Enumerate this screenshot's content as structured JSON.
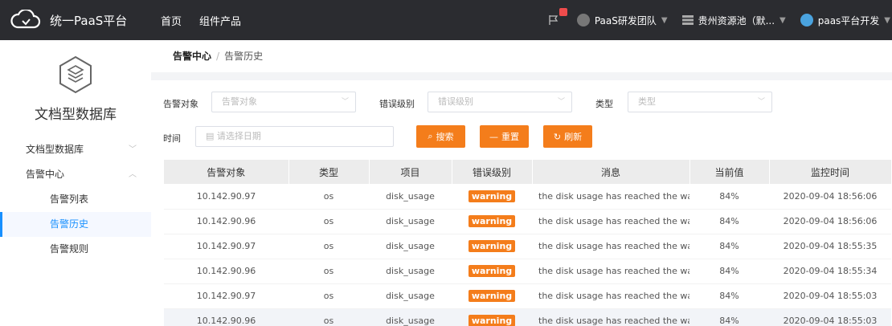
{
  "header": {
    "app_title": "统一PaaS平台",
    "nav": [
      "首页",
      "组件产品"
    ],
    "team": "PaaS研发团队",
    "pool": "贵州资源池（默...",
    "user": "paas平台开发"
  },
  "sidebar": {
    "db_title": "文档型数据库",
    "items": [
      {
        "label": "文档型数据库"
      },
      {
        "label": "告警中心"
      },
      {
        "label": "告警列表"
      },
      {
        "label": "告警历史"
      },
      {
        "label": "告警规则"
      }
    ]
  },
  "breadcrumb": {
    "parent": "告警中心",
    "sep": "/",
    "current": "告警历史"
  },
  "filters": {
    "target": {
      "label": "告警对象",
      "placeholder": "告警对象"
    },
    "level": {
      "label": "错误级别",
      "placeholder": "错误级别"
    },
    "type": {
      "label": "类型",
      "placeholder": "类型"
    },
    "time": {
      "label": "时间",
      "placeholder": "请选择日期"
    }
  },
  "buttons": {
    "search": "搜索",
    "reset": "重置",
    "refresh": "刷新"
  },
  "table": {
    "headers": [
      "告警对象",
      "类型",
      "项目",
      "错误级别",
      "消息",
      "当前值",
      "监控时间"
    ],
    "rows": [
      [
        "10.142.90.97",
        "os",
        "disk_usage",
        "warning",
        "the disk usage has reached the warn...",
        "84%",
        "2020-09-04 18:56:06"
      ],
      [
        "10.142.90.96",
        "os",
        "disk_usage",
        "warning",
        "the disk usage has reached the warn...",
        "84%",
        "2020-09-04 18:56:06"
      ],
      [
        "10.142.90.97",
        "os",
        "disk_usage",
        "warning",
        "the disk usage has reached the warn...",
        "84%",
        "2020-09-04 18:55:35"
      ],
      [
        "10.142.90.96",
        "os",
        "disk_usage",
        "warning",
        "the disk usage has reached the warn...",
        "84%",
        "2020-09-04 18:55:34"
      ],
      [
        "10.142.90.97",
        "os",
        "disk_usage",
        "warning",
        "the disk usage has reached the warn...",
        "84%",
        "2020-09-04 18:55:03"
      ],
      [
        "10.142.90.96",
        "os",
        "disk_usage",
        "warning",
        "the disk usage has reached the warn...",
        "84%",
        "2020-09-04 18:55:03"
      ]
    ]
  },
  "colors": {
    "topbar": "#2b2c30",
    "accent": "#f47d1b",
    "active": "#1890ff",
    "notification": "#ef4c4c"
  },
  "icons": [
    "cloud-logo-icon",
    "flag-icon",
    "team-avatar-icon",
    "resource-pool-icon",
    "user-avatar-icon",
    "hexagon-db-icon",
    "calendar-icon",
    "search-icon",
    "minus-icon",
    "refresh-icon"
  ]
}
